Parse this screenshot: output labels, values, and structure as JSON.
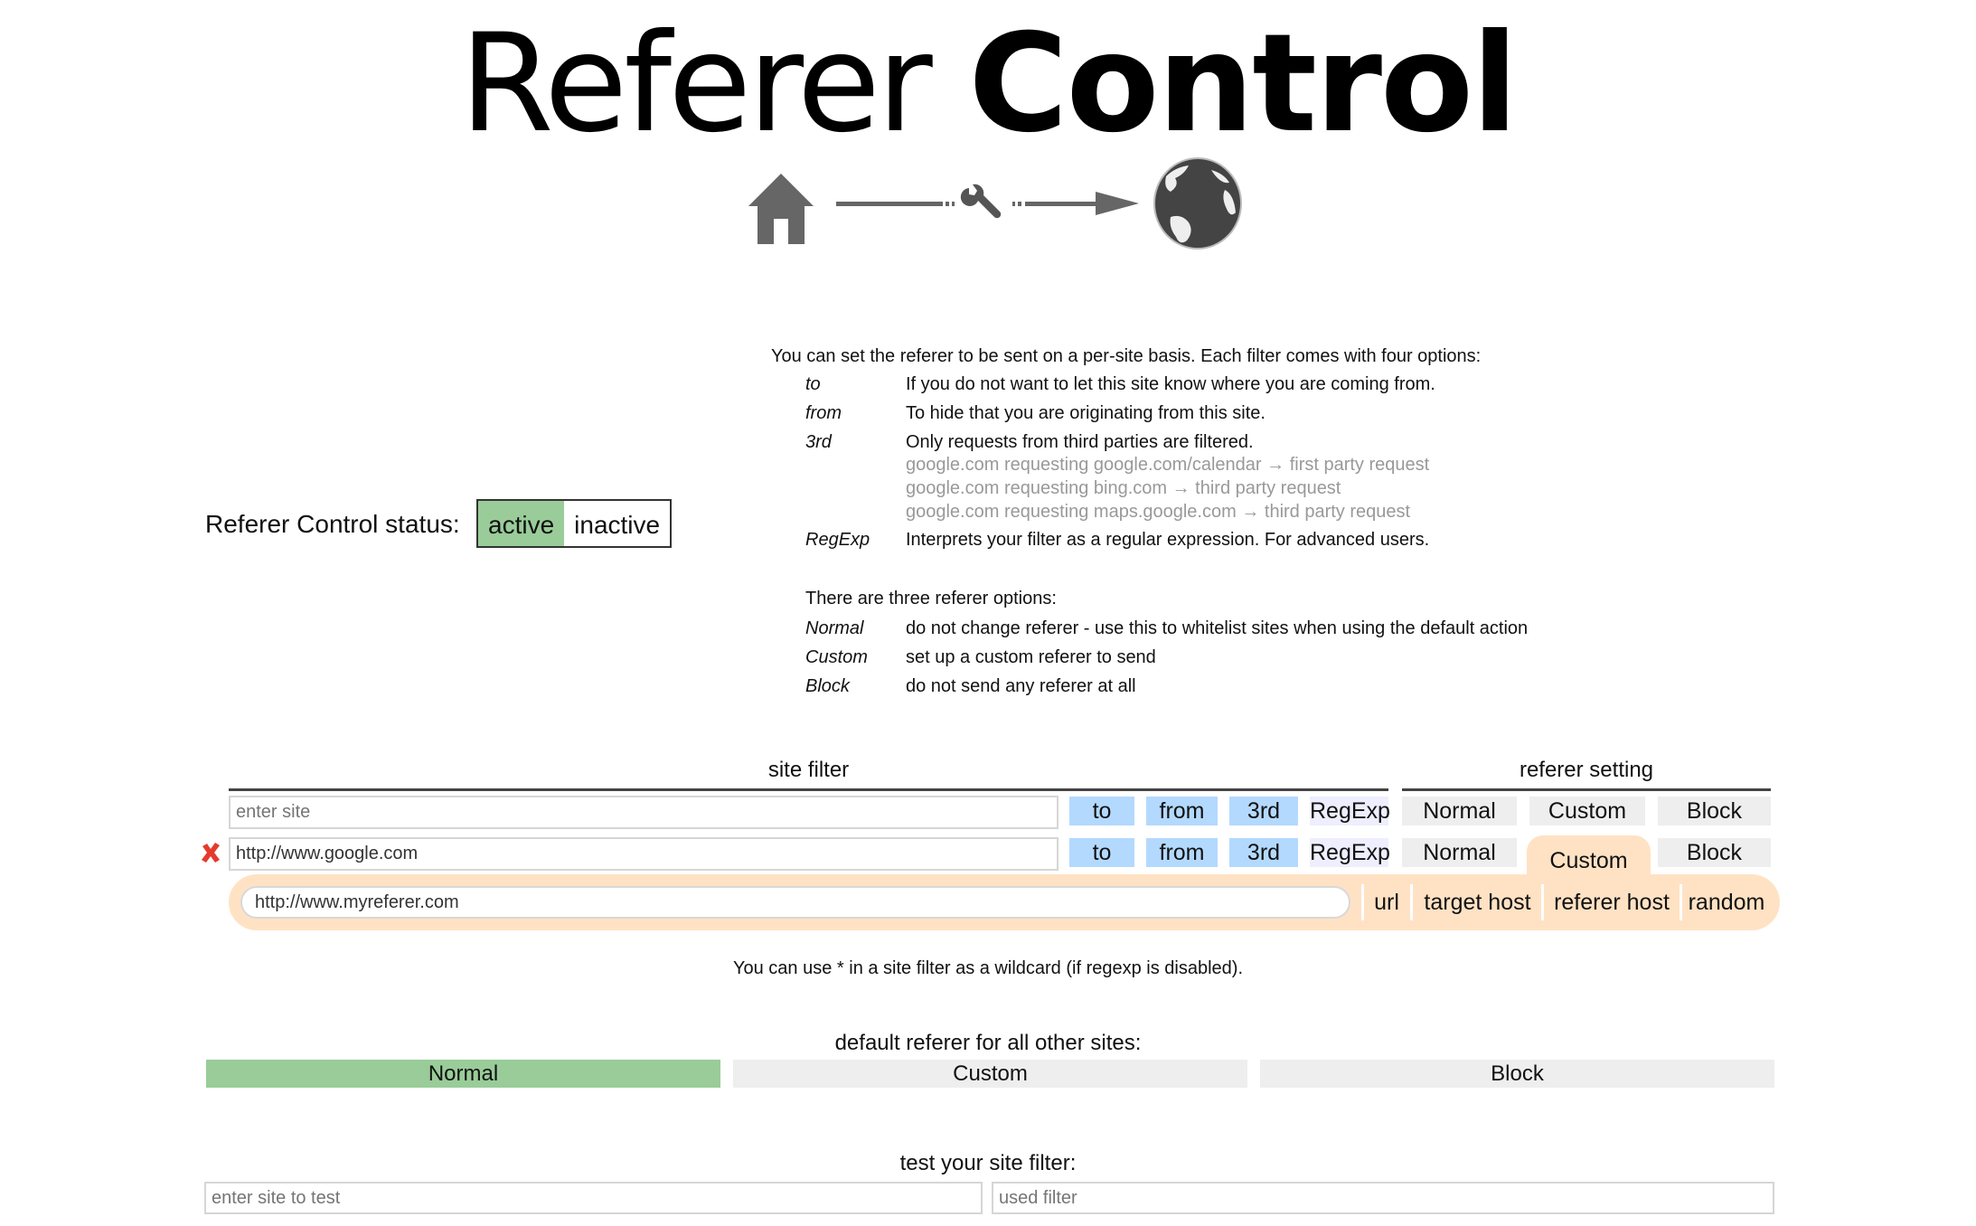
{
  "header": {
    "title_light": "Referer",
    "title_bold": "Control",
    "logo_icons": [
      "home-icon",
      "arrow-line",
      "wrench-icon",
      "arrow-head",
      "globe-icon"
    ]
  },
  "status": {
    "label": "Referer Control status:",
    "options": [
      "active",
      "inactive"
    ],
    "selected": "active"
  },
  "description": {
    "intro": "You can set the referer to be sent on a per-site basis. Each filter comes with four options:",
    "filter_options": [
      {
        "term": "to",
        "text": "If you do not want to let this site know where you are coming from."
      },
      {
        "term": "from",
        "text": "To hide that you are originating from this site."
      },
      {
        "term": "3rd",
        "text": "Only requests from third parties are filtered."
      },
      {
        "term": "RegExp",
        "text": "Interprets your filter as a regular expression. For advanced users."
      }
    ],
    "third_party_examples": [
      "google.com requesting google.com/calendar → first party request",
      "google.com requesting bing.com → third party request",
      "google.com requesting maps.google.com → third party request"
    ],
    "referer_intro": "There are three referer options:",
    "referer_options": [
      {
        "term": "Normal",
        "text": "do not change referer - use this to whitelist sites when using the default action"
      },
      {
        "term": "Custom",
        "text": "set up a custom referer to send"
      },
      {
        "term": "Block",
        "text": "do not send any referer at all"
      }
    ]
  },
  "filter_table": {
    "site_filter_header": "site filter",
    "referer_setting_header": "referer setting",
    "new_row": {
      "placeholder": "enter site",
      "flags": [
        "to",
        "from",
        "3rd",
        "RegExp"
      ],
      "settings": [
        "Normal",
        "Custom",
        "Block"
      ]
    },
    "rows": [
      {
        "site": "http://www.google.com",
        "flags": [
          "to",
          "from",
          "3rd",
          "RegExp"
        ],
        "settings": [
          "Normal",
          "Custom",
          "Block"
        ],
        "selected_setting": "Custom",
        "custom_referer": "http://www.myreferer.com",
        "custom_options": [
          "url",
          "target host",
          "referer host",
          "random"
        ]
      }
    ],
    "wildcard_note": "You can use * in a site filter as a wildcard (if regexp is disabled)."
  },
  "default_referer": {
    "label": "default referer for all other sites:",
    "options": [
      "Normal",
      "Custom",
      "Block"
    ],
    "selected": "Normal"
  },
  "test": {
    "label": "test your site filter:",
    "site_placeholder": "enter site to test",
    "used_filter_placeholder": "used filter"
  },
  "colors": {
    "active_green": "#99cc99",
    "flag_blue": "#b3d9ff",
    "regexp_lavender": "#eeeeff",
    "setting_gray": "#eeeeee",
    "custom_orange": "#ffe2c4",
    "example_grey": "#999999"
  }
}
